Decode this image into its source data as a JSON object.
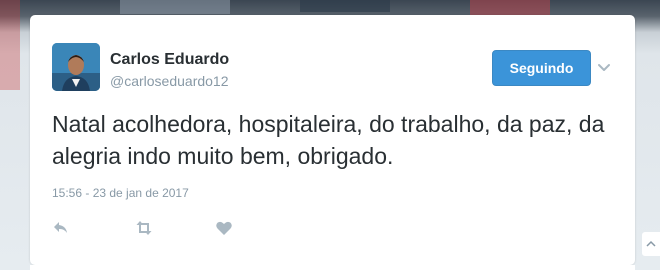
{
  "tweet": {
    "author_name": "Carlos Eduardo",
    "author_handle": "@carloseduardo12",
    "follow_button_label": "Seguindo",
    "text": "Natal acolhedora, hospitaleira, do trabalho, da paz, da alegria indo muito bem, obrigado.",
    "timestamp": "15:56 - 23 de jan de 2017",
    "actions": [
      {
        "name": "reply",
        "icon": "reply-icon"
      },
      {
        "name": "retweet",
        "icon": "retweet-icon"
      },
      {
        "name": "like",
        "icon": "heart-icon"
      }
    ]
  },
  "colors": {
    "follow_button": "#3b94d9",
    "text_primary": "#292f33",
    "text_secondary": "#8899a6",
    "icon_gray": "#aab8c2"
  }
}
